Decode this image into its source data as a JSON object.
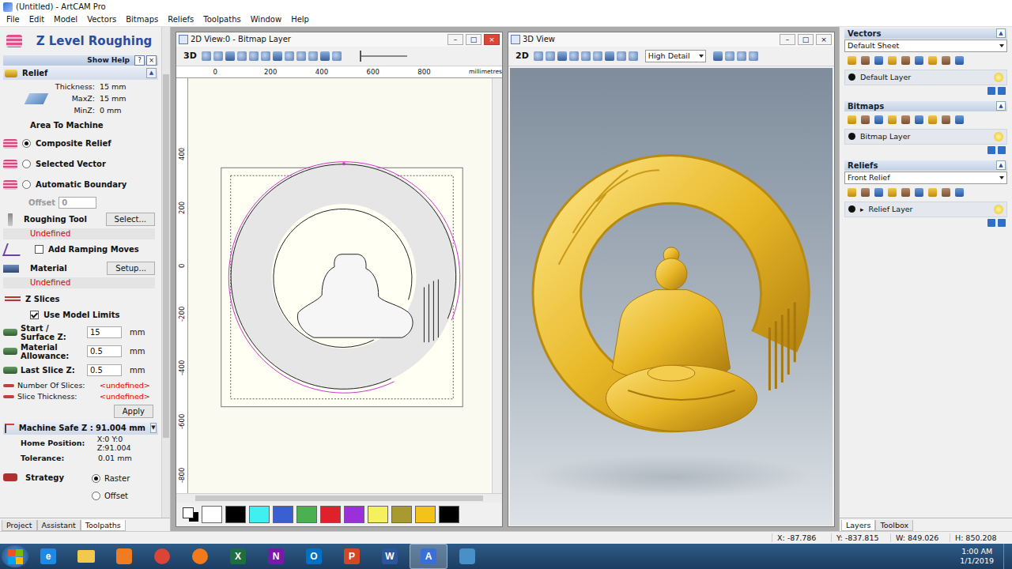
{
  "window": {
    "title": "(Untitled) - ArtCAM Pro"
  },
  "menu": [
    "File",
    "Edit",
    "Model",
    "Vectors",
    "Bitmaps",
    "Reliefs",
    "Toolpaths",
    "Window",
    "Help"
  ],
  "left_panel": {
    "title": "Z Level Roughing",
    "show_help": "Show Help",
    "help": "?",
    "close": "×",
    "relief": {
      "heading": "Relief",
      "toggle": "▲",
      "rows": [
        {
          "label": "Thickness:",
          "value": "15 mm"
        },
        {
          "label": "MaxZ:",
          "value": "15 mm"
        },
        {
          "label": "MinZ:",
          "value": "0 mm"
        }
      ]
    },
    "area": {
      "heading": "Area To Machine",
      "options": [
        {
          "label": "Composite Relief",
          "selected": true
        },
        {
          "label": "Selected Vector",
          "selected": false
        },
        {
          "label": "Automatic Boundary",
          "selected": false
        }
      ],
      "offset_label": "Offset",
      "offset_value": "0",
      "offset_disabled": true
    },
    "roughing_tool": {
      "label": "Roughing Tool",
      "button": "Select...",
      "status": "Undefined"
    },
    "ramping": {
      "label": "Add Ramping Moves",
      "checked": false
    },
    "material": {
      "label": "Material",
      "button": "Setup...",
      "status": "Undefined"
    },
    "z_slices": {
      "heading": "Z Slices",
      "use_model_limits": {
        "label": "Use Model Limits",
        "checked": true
      },
      "fields": [
        {
          "label": "Start / Surface Z:",
          "value": "15",
          "unit": "mm"
        },
        {
          "label": "Material Allowance:",
          "value": "0.5",
          "unit": "mm"
        },
        {
          "label": "Last Slice Z:",
          "value": "0.5",
          "unit": "mm"
        }
      ],
      "readouts": [
        {
          "label": "Number Of Slices:",
          "value": "<undefined>"
        },
        {
          "label": "Slice Thickness:",
          "value": "<undefined>"
        }
      ],
      "apply": "Apply"
    },
    "safe_z": {
      "heading": "Machine Safe Z : 91.004 mm",
      "toggle": "▼",
      "rows": [
        {
          "label": "Home Position:",
          "value": "X:0 Y:0 Z:91.004"
        },
        {
          "label": "Tolerance:",
          "value": "0.01 mm"
        }
      ]
    },
    "strategy": {
      "label": "Strategy",
      "options": [
        {
          "label": "Raster",
          "selected": true
        },
        {
          "label": "Offset",
          "selected": false
        }
      ]
    },
    "tabs": [
      {
        "label": "Project",
        "selected": false
      },
      {
        "label": "Assistant",
        "selected": false
      },
      {
        "label": "Toolpaths",
        "selected": true
      }
    ]
  },
  "view2d": {
    "title": "2D View:0 - Bitmap Layer",
    "buttons": [
      "–",
      "□",
      "×"
    ],
    "mode": "3D",
    "ruler_x": [
      "0",
      "200",
      "400",
      "600",
      "800"
    ],
    "units": "millimetres",
    "ruler_y": [
      "400",
      "200",
      "0",
      "-200",
      "-400",
      "-600",
      "-800"
    ],
    "palette": [
      {
        "color": "#ffffff"
      },
      {
        "color": "#000000"
      },
      {
        "color": "#3ff0f0"
      },
      {
        "color": "#3a5fd0"
      },
      {
        "color": "#4caf50"
      },
      {
        "color": "#e0202a"
      },
      {
        "color": "#9b2fd8"
      },
      {
        "color": "#f5f060"
      },
      {
        "color": "#a89a30"
      },
      {
        "color": "#f3c417"
      },
      {
        "color": "#000000"
      }
    ]
  },
  "view3d": {
    "title": "3D View",
    "buttons": [
      "–",
      "□",
      "×"
    ],
    "mode": "2D",
    "detail": "High Detail"
  },
  "right_panel": {
    "sections": [
      {
        "heading": "Vectors",
        "toggle": "▲",
        "dropdown": "Default Sheet",
        "layer": "Default Layer"
      },
      {
        "heading": "Bitmaps",
        "toggle": "▲",
        "layer": "Bitmap Layer"
      },
      {
        "heading": "Reliefs",
        "toggle": "▲",
        "dropdown": "Front Relief",
        "layer": "Relief Layer",
        "expander": "▸"
      }
    ],
    "tabs": [
      {
        "label": "Layers",
        "selected": true
      },
      {
        "label": "Toolbox",
        "selected": false
      }
    ]
  },
  "status_bar": [
    "X: -87.786",
    "Y: -837.815",
    "W: 849.026",
    "H: 850.208"
  ],
  "taskbar": {
    "time": "1:00 AM",
    "date": "1/1/2019",
    "apps": [
      {
        "kind": "letter",
        "glyph": "e",
        "color": "#1e88e5",
        "active": false
      },
      {
        "kind": "folder",
        "color": "#f2c94c",
        "active": false
      },
      {
        "kind": "media",
        "color": "#f07b20",
        "active": false
      },
      {
        "kind": "round",
        "color": "#db4437",
        "active": false
      },
      {
        "kind": "round",
        "color": "#f27a1a",
        "active": false
      },
      {
        "kind": "letter",
        "glyph": "X",
        "color": "#1d6f42",
        "active": false
      },
      {
        "kind": "letter",
        "glyph": "N",
        "color": "#7719aa",
        "active": false
      },
      {
        "kind": "letter",
        "glyph": "O",
        "color": "#0072c6",
        "active": false
      },
      {
        "kind": "letter",
        "glyph": "P",
        "color": "#d24726",
        "active": false
      },
      {
        "kind": "letter",
        "glyph": "W",
        "color": "#2b579a",
        "active": false
      },
      {
        "kind": "letter",
        "glyph": "A",
        "color": "#3a6fd8",
        "active": true
      },
      {
        "kind": "media",
        "color": "#4a90c8",
        "active": false
      }
    ]
  }
}
